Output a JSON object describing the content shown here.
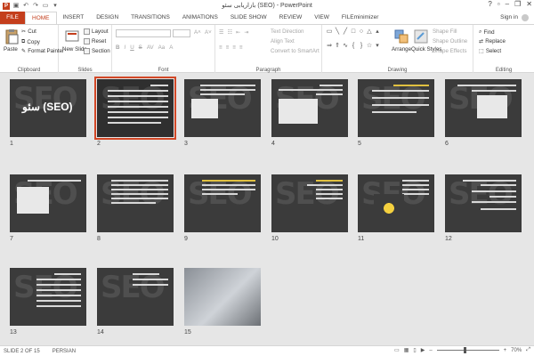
{
  "titlebar": {
    "title": "بازاریابی سئو (SEO) - PowerPoint",
    "minimize": "–",
    "restore": "❐",
    "close": "✕",
    "help": "?"
  },
  "tabs": [
    "FILE",
    "HOME",
    "INSERT",
    "DESIGN",
    "TRANSITIONS",
    "ANIMATIONS",
    "SLIDE SHOW",
    "REVIEW",
    "VIEW",
    "FILEminimizer"
  ],
  "signin": "Sign in",
  "ribbon": {
    "clipboard": {
      "paste": "Paste",
      "cut": "Cut",
      "copy": "Copy",
      "format_painter": "Format Painter",
      "label": "Clipboard"
    },
    "slides": {
      "new_slide": "New Slide",
      "layout": "Layout",
      "reset": "Reset",
      "section": "Section",
      "label": "Slides"
    },
    "font": {
      "label": "Font"
    },
    "paragraph": {
      "text_direction": "Text Direction",
      "align_text": "Align Text",
      "convert_smartart": "Convert to SmartArt",
      "label": "Paragraph"
    },
    "drawing": {
      "arrange": "Arrange",
      "quick_styles": "Quick Styles",
      "shape_fill": "Shape Fill",
      "shape_outline": "Shape Outline",
      "shape_effects": "Shape Effects",
      "label": "Drawing"
    },
    "editing": {
      "find": "Find",
      "replace": "Replace",
      "select": "Select",
      "label": "Editing"
    }
  },
  "slides": [
    {
      "num": "1",
      "title": "سئو (SEO)"
    },
    {
      "num": "2",
      "title": ""
    },
    {
      "num": "3",
      "title": ""
    },
    {
      "num": "4",
      "title": ""
    },
    {
      "num": "5",
      "title": ""
    },
    {
      "num": "6",
      "title": ""
    },
    {
      "num": "7",
      "title": ""
    },
    {
      "num": "8",
      "title": ""
    },
    {
      "num": "9",
      "title": ""
    },
    {
      "num": "10",
      "title": ""
    },
    {
      "num": "11",
      "title": ""
    },
    {
      "num": "12",
      "title": ""
    },
    {
      "num": "13",
      "title": ""
    },
    {
      "num": "14",
      "title": ""
    },
    {
      "num": "15",
      "title": ""
    }
  ],
  "selected_slide": 2,
  "status": {
    "slide_of": "SLIDE 2 OF 15",
    "language": "PERSIAN",
    "zoom": "70%"
  },
  "colors": {
    "accent": "#c43e1c",
    "selection": "#d24726",
    "slide_bg": "#3b3b3b",
    "workspace": "#e6e6e6"
  }
}
